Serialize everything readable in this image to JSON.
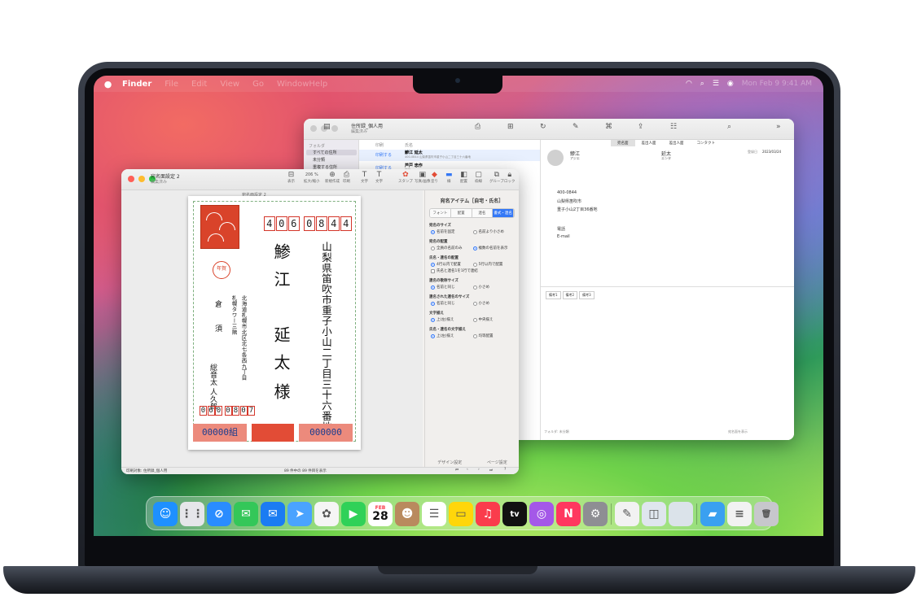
{
  "menubar": {
    "app": "Finder",
    "items": [
      "File",
      "Edit",
      "View",
      "Go",
      "Window",
      "Help"
    ],
    "clock": "Mon Feb 9 9:41 AM"
  },
  "back_window": {
    "title": "住所録_個人用",
    "subtitle": "編集済み",
    "sidebar_header": "フォルダ",
    "sidebar_items": [
      "すべての住所",
      "未分類",
      "重複する住所"
    ],
    "list_header_a": "印刷",
    "list_header_b": "氏名",
    "list_rows": [
      {
        "print": "印刷する",
        "name": "鯵江 延太",
        "sub": "400-0844 山梨県笛吹市重子小山二丁目三十六番地"
      },
      {
        "print": "印刷する",
        "name": "芦戸 忠作",
        "sub": "新宿"
      }
    ],
    "tabs": [
      "宛名面",
      "差出人面",
      "差出人面"
    ],
    "contact_tab": "コンタクト",
    "family_name": "鯵江",
    "given_name": "延太",
    "family_kana": "アジエ",
    "given_kana": "エンタ",
    "date_label": "登録日",
    "date_value": "2023/03/24",
    "postal": "400-0844",
    "address_lines": [
      "山梨県笛吹市",
      "重子小山2丁目36番地"
    ],
    "phone_label": "電話",
    "email_label": "E-mail",
    "memo_tabs": [
      "備考1",
      "備考2",
      "備考3"
    ],
    "footer_left": "フォルダ: 未分類",
    "footer_right": "宛名面を表示"
  },
  "front_window": {
    "title": "宛名面設定 2",
    "subtitle": "編集済み",
    "toolbar": [
      "表示",
      "拡大/縮小",
      "新規作成",
      "印刷",
      "文字",
      "文字",
      "スタンプ",
      "写真/画像",
      "塗り",
      "線",
      "配置",
      "枠線",
      "グループ",
      "ロック"
    ],
    "zoom": "206 %",
    "doc_title": "宛名面設定 2",
    "inspector": {
      "title": "宛名アイテム［自宅・氏名］",
      "tabs": [
        "フォント",
        "配置",
        "連名",
        "書式・連名"
      ],
      "sections": [
        {
          "label": "宛名のサイズ",
          "options": [
            [
              "名前を固定",
              true
            ],
            [
              "名前より小さめ",
              false
            ]
          ]
        },
        {
          "label": "宛名の配置",
          "options": [
            [
              "全員の名前のみ",
              false
            ],
            [
              "複数の名前を表示",
              true
            ]
          ]
        },
        {
          "label": "氏名・連名の配置",
          "options": [
            [
              "4行以内で配置",
              true
            ],
            [
              "5行以内で配置",
              false
            ]
          ]
        },
        {
          "label": "連名の敬称サイズ",
          "options": [
            [
              "名前と同じ",
              true
            ],
            [
              "小さめ",
              false
            ]
          ]
        },
        {
          "label": "連名された連名のサイズ",
          "options": [
            [
              "名前と同じ",
              true
            ],
            [
              "小さめ",
              false
            ]
          ]
        },
        {
          "label": "文字揃え",
          "options": [
            [
              "上(左)揃え",
              true
            ],
            [
              "中央揃え",
              false
            ]
          ]
        },
        {
          "label": "氏名・連名の文字揃え",
          "options": [
            [
              "上(左)揃え",
              true
            ],
            [
              "均等配置",
              false
            ]
          ]
        }
      ],
      "extra_checkbox": "氏名と連名1を1行で連結",
      "foot_left": "デザイン設定",
      "foot_right": "ページ設定"
    },
    "status": "印刷対象: 住所録_個人用",
    "page_status": "89 件中の 89 件目を表示"
  },
  "postcard": {
    "zip_to": [
      "4",
      "0",
      "6",
      "0",
      "8",
      "4",
      "4"
    ],
    "address": "山梨県笛吹市重子小山二丁目三十六番地",
    "recipient_family": "鯵江",
    "recipient_given": "延太",
    "honorific": "様",
    "sender_address": [
      "北海道札幌市北区北七条西九丁目",
      "札幌タワー三階"
    ],
    "sender_names": [
      "倉",
      "須",
      "総音太",
      "人久郎"
    ],
    "seal_text": "年賀",
    "zip_from": [
      "0",
      "6",
      "0",
      "0",
      "8",
      "0",
      "7"
    ],
    "lottery_left": "00000組",
    "lottery_right": "000000"
  },
  "dock": {
    "apps": [
      "Finder",
      "Launchpad",
      "Safari",
      "Messages",
      "Mail",
      "Maps",
      "Photos",
      "FaceTime",
      "Calendar",
      "Contacts",
      "Reminders",
      "Notes",
      "Music",
      "TV",
      "Podcasts",
      "News",
      "System Settings",
      "TextEdit",
      "Preview",
      "Generic",
      "Folder",
      "Document",
      "Trash"
    ],
    "calendar_month": "FEB",
    "calendar_day": "28"
  },
  "colors": {
    "accent": "#3478f6",
    "stamp_red": "#d9432a",
    "zip_box": "#d4362a"
  }
}
